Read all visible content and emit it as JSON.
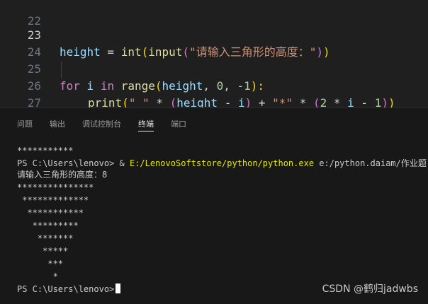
{
  "editor": {
    "lines": [
      {
        "number": "22"
      },
      {
        "number": "23",
        "tokens": [
          "height",
          " = ",
          "int",
          "(",
          "input",
          "(",
          "\"请输入三角形的高度：\"",
          ")",
          ")"
        ]
      },
      {
        "number": "24"
      },
      {
        "number": "25",
        "tokens": [
          "for",
          " ",
          "i",
          " ",
          "in",
          " ",
          "range",
          "(",
          "height",
          ", ",
          "0",
          ", ",
          "-1",
          "):"
        ]
      },
      {
        "number": "26",
        "tokens": [
          "print",
          "(",
          "\" \"",
          " * ",
          "(",
          "height",
          " - ",
          "i",
          ")",
          " + ",
          "\"*\"",
          " * ",
          "(",
          "2",
          " * ",
          "i",
          " - ",
          "1",
          ")",
          ")"
        ]
      },
      {
        "number": "27"
      }
    ]
  },
  "panel": {
    "tabs": [
      "问题",
      "输出",
      "调试控制台",
      "终端",
      "端口"
    ],
    "active_tab": "终端"
  },
  "terminal": {
    "prev_output": "***********",
    "prompt": "PS C:\\Users\\lenovo> ",
    "amp": "& ",
    "exe_path": "E:/LenovoSoftstore/python/python.exe",
    "script_path": " e:/python.daiam/作业题.py",
    "input_prompt": "请输入三角形的高度：8",
    "triangle": [
      "***************",
      " *************",
      "  ***********",
      "   *********",
      "    *******",
      "     *****",
      "      ***",
      "       *"
    ],
    "final_prompt": "PS C:\\Users\\lenovo>"
  },
  "watermark": "CSDN @鹤归jadwbs"
}
